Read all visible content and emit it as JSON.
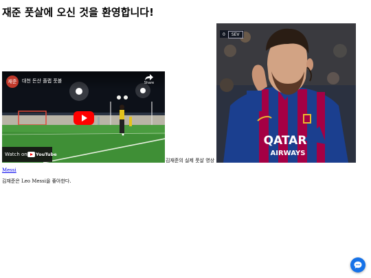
{
  "page": {
    "title": "재준 풋살에 오신 것을 환영합니다!"
  },
  "video": {
    "channel_avatar_text": "재준",
    "title": "대천 돈산 플랩 풋볼",
    "share_label": "Share",
    "watch_on_label": "Watch on",
    "youtube_logo_text": "YouTube",
    "caption": "김재준의 실제 풋살 영상"
  },
  "photo": {
    "score_value": "0",
    "score_team": "SEV",
    "shirt_sponsor_line1": "QATAR",
    "shirt_sponsor_line2": "AIRWAYS"
  },
  "links": {
    "messi_label": "Messi"
  },
  "body_text": {
    "about": "김재준은 Leo Messi을 좋아한다."
  },
  "icons": {
    "share": "share-arrow-icon",
    "play": "youtube-play-icon",
    "chat": "chat-bubble-icon"
  },
  "colors": {
    "youtube_red": "#ff0000",
    "link_blue": "#0000ee",
    "chat_button": "#1672e8",
    "barca_blue": "#1b3f8f",
    "barca_red": "#a50044"
  }
}
